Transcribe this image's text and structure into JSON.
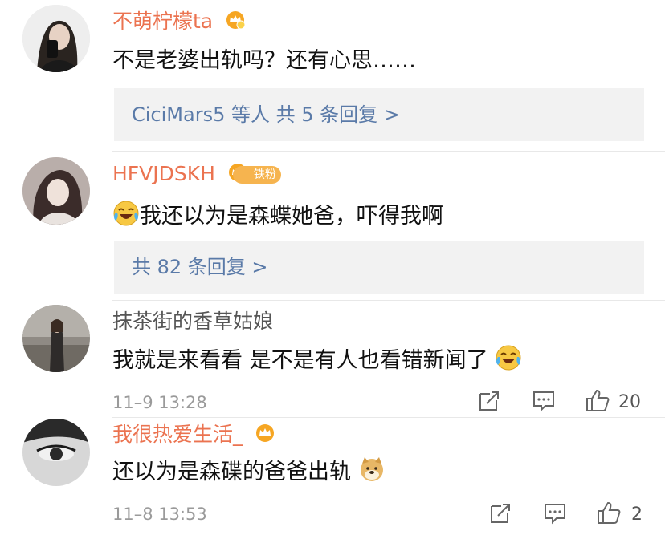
{
  "comments": [
    {
      "username": "不萌柠檬ta",
      "text": "不是老婆出轨吗？还有心思……",
      "reply_summary": "CiciMars5 等人  共 5 条回复 >"
    },
    {
      "username": "HFVJDSKH",
      "fan_badge": "铁粉",
      "text": "我还以为是森蝶她爸，吓得我啊",
      "reply_summary": "共 82 条回复 >"
    },
    {
      "username": "抹茶街的香草姑娘",
      "text": "我就是来看看 是不是有人也看错新闻了",
      "time": "11–9 13:28",
      "likes": "20"
    },
    {
      "username": "我很热爱生活_",
      "text": "还以为是森碟的爸爸出轨",
      "time": "11–8 13:53",
      "likes": "2"
    }
  ],
  "colors": {
    "vip_name": "#eb7350",
    "plain_name": "#555555",
    "reply_link": "#5a7aa8",
    "reply_bg": "#f2f2f2",
    "meta": "#9a9a9a"
  }
}
